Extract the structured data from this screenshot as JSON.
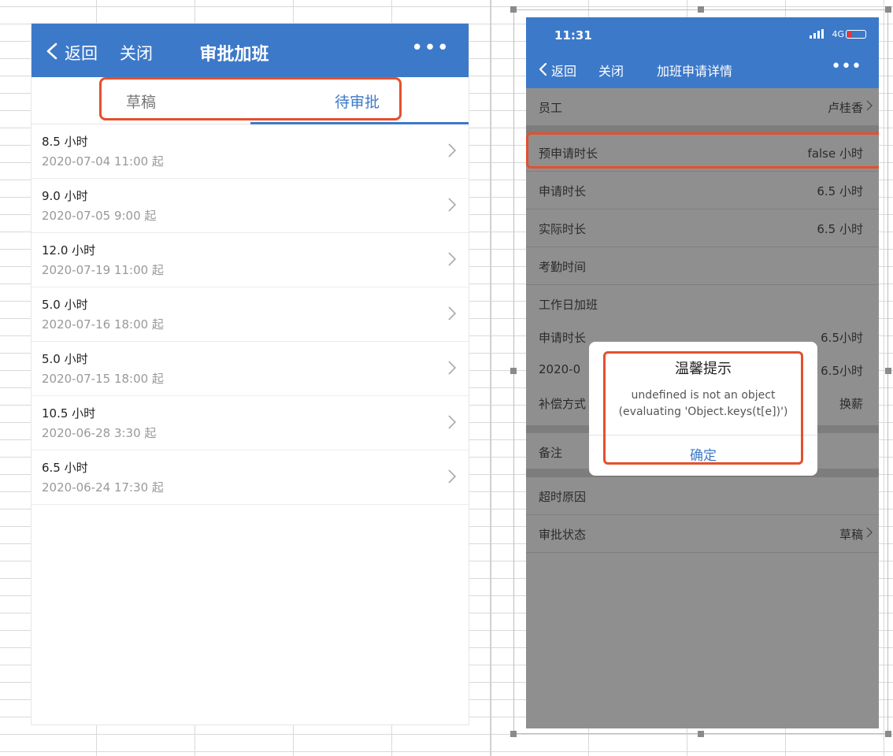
{
  "left_screen": {
    "nav": {
      "back_label": "返回",
      "close_label": "关闭",
      "title": "审批加班",
      "more_label": "•••"
    },
    "tabs": [
      {
        "label": "草稿",
        "active": false
      },
      {
        "label": "待审批",
        "active": true
      }
    ],
    "items": [
      {
        "hours": "8.5 小时",
        "start": "2020-07-04 11:00 起"
      },
      {
        "hours": "9.0 小时",
        "start": "2020-07-05 9:00 起"
      },
      {
        "hours": "12.0 小时",
        "start": "2020-07-19 11:00 起"
      },
      {
        "hours": "5.0 小时",
        "start": "2020-07-16 18:00 起"
      },
      {
        "hours": "5.0 小时",
        "start": "2020-07-15 18:00 起"
      },
      {
        "hours": "10.5 小时",
        "start": "2020-06-28 3:30 起"
      },
      {
        "hours": "6.5 小时",
        "start": "2020-06-24 17:30 起"
      }
    ]
  },
  "right_screen": {
    "status": {
      "time": "11:31",
      "network": "4G"
    },
    "nav": {
      "back_label": "返回",
      "close_label": "关闭",
      "title": "加班申请详情",
      "more_label": "•••"
    },
    "rows": {
      "employee": {
        "label": "员工",
        "value": "卢桂香"
      },
      "pre_duration": {
        "label": "预申请时长",
        "value": "false 小时"
      },
      "apply_duration": {
        "label": "申请时长",
        "value": "6.5 小时"
      },
      "actual_duration": {
        "label": "实际时长",
        "value": "6.5 小时"
      },
      "attendance": {
        "label": "考勤时间",
        "value": ""
      },
      "section_workday": {
        "label": "工作日加班",
        "value": ""
      },
      "sub_apply": {
        "label": "申请时长",
        "value": "6.5小时"
      },
      "sub_date": {
        "label": "2020-0",
        "value": "6.5小时"
      },
      "compensation": {
        "label": "补偿方式",
        "value": "换薪"
      },
      "remark": {
        "label": "备注",
        "value": ""
      },
      "overtime_reason": {
        "label": "超时原因",
        "value": ""
      },
      "approval_status": {
        "label": "审批状态",
        "value": "草稿"
      }
    },
    "dialog": {
      "title": "温馨提示",
      "message_line1": "undefined is not an object",
      "message_line2": "(evaluating 'Object.keys(t[e])')",
      "ok_label": "确定"
    }
  },
  "colors": {
    "brand_blue": "#3d79c9",
    "highlight_red": "#e4502d",
    "overlay_gray": "#8f8f8f"
  }
}
